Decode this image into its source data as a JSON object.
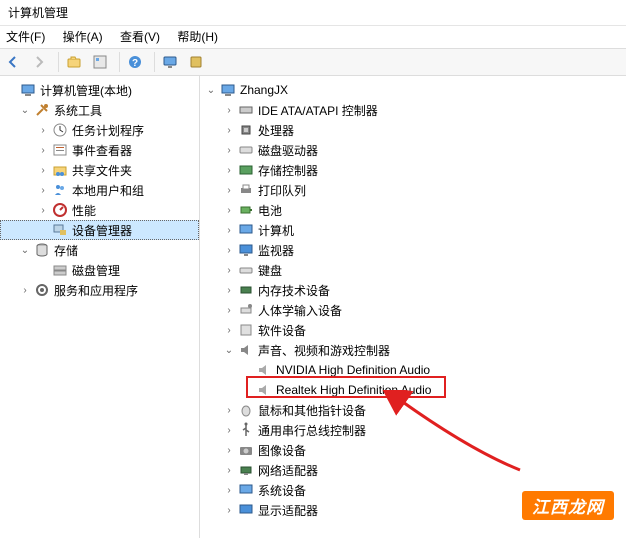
{
  "window": {
    "title": "计算机管理"
  },
  "menu": {
    "file": "文件(F)",
    "action": "操作(A)",
    "view": "查看(V)",
    "help": "帮助(H)"
  },
  "toolbar_icons": {
    "back": "back",
    "forward": "forward",
    "up": "up",
    "folder": "folder",
    "panes": "panes",
    "help": "help",
    "a1": "a1",
    "a2": "a2"
  },
  "left_tree": {
    "root": "计算机管理(本地)",
    "system_tools": "系统工具",
    "task_scheduler": "任务计划程序",
    "event_viewer": "事件查看器",
    "shared_folders": "共享文件夹",
    "local_users": "本地用户和组",
    "performance": "性能",
    "device_manager": "设备管理器",
    "storage": "存储",
    "disk_mgmt": "磁盘管理",
    "services": "服务和应用程序"
  },
  "right_tree": {
    "root": "ZhangJX",
    "ide": "IDE ATA/ATAPI 控制器",
    "cpu": "处理器",
    "diskdrive": "磁盘驱动器",
    "storage_ctrl": "存储控制器",
    "print_queue": "打印队列",
    "battery": "电池",
    "computer": "计算机",
    "monitor": "监视器",
    "keyboard": "键盘",
    "memory": "内存技术设备",
    "hid": "人体学输入设备",
    "software": "软件设备",
    "sound": "声音、视频和游戏控制器",
    "nvidia_audio": "NVIDIA High Definition Audio",
    "realtek_audio": "Realtek High Definition Audio",
    "mouse": "鼠标和其他指针设备",
    "usb": "通用串行总线控制器",
    "imaging": "图像设备",
    "network": "网络适配器",
    "system_dev": "系统设备",
    "display": "显示适配器"
  },
  "watermark": "江西龙网"
}
